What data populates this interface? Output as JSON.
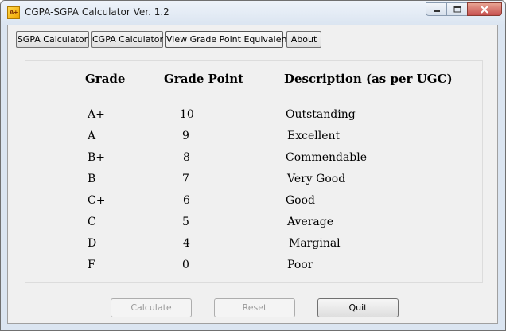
{
  "window": {
    "title": "CGPA-SGPA Calculator Ver. 1.2",
    "icon": "calculator-app-icon"
  },
  "tabs": [
    {
      "label": "SGPA Calculator"
    },
    {
      "label": "CGPA Calculator"
    },
    {
      "label": "View Grade Point Equivalent"
    },
    {
      "label": "About"
    }
  ],
  "table": {
    "headers": {
      "grade": "Grade",
      "point": "Grade Point",
      "description": "Description (as per UGC)"
    },
    "rows": [
      {
        "grade": "A+",
        "point": "10",
        "description": "Outstanding"
      },
      {
        "grade": "A",
        "point": "9",
        "description": "Excellent"
      },
      {
        "grade": "B+",
        "point": "8",
        "description": "Commendable"
      },
      {
        "grade": "B",
        "point": "7",
        "description": "Very Good"
      },
      {
        "grade": "C+",
        "point": "6",
        "description": "Good"
      },
      {
        "grade": "C",
        "point": "5",
        "description": "Average"
      },
      {
        "grade": "D",
        "point": "4",
        "description": "Marginal"
      },
      {
        "grade": "F",
        "point": "0",
        "description": "Poor"
      }
    ]
  },
  "buttons": {
    "calculate": "Calculate",
    "reset": "Reset",
    "quit": "Quit"
  },
  "colors": {
    "window_frame": "#dbe5f1",
    "client_bg": "#f0f0f0",
    "close_button": "#c75050"
  }
}
